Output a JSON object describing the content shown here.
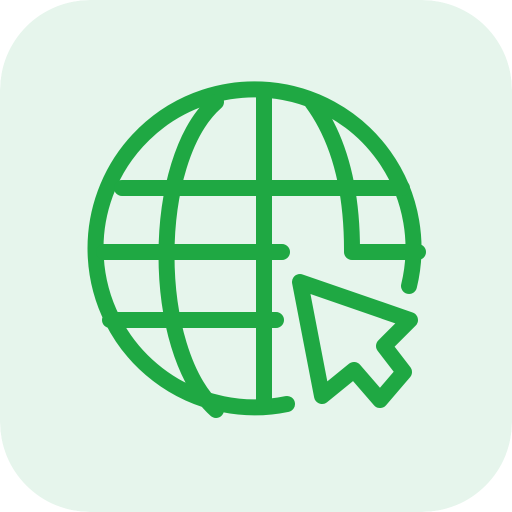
{
  "app_icon": {
    "icon": "globe-with-cursor-icon",
    "background_color": "#e6f5ec",
    "stroke_color": "#1fa843"
  }
}
